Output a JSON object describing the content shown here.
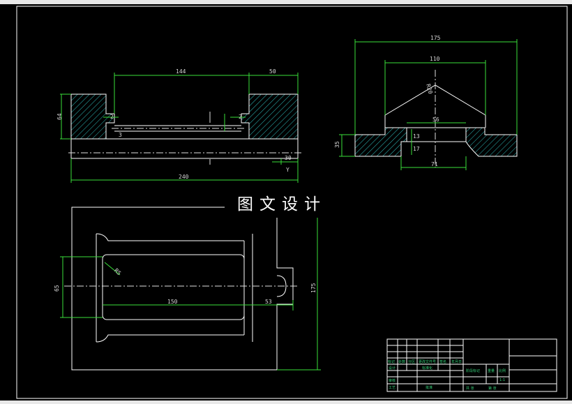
{
  "colors": {
    "background": "#000000",
    "outline": "#ffffff",
    "dimension": "#3adf3a",
    "hatch": "#2fbfbf",
    "centerline": "#e0e0e0",
    "text": "#d8d8d8",
    "title_block_text": "#36d27a"
  },
  "watermark": "图文设计",
  "front_view": {
    "dims": {
      "length_144": "144",
      "length_50": "50",
      "height_64": "64",
      "depth_2_left": "2",
      "depth_2_right": "2",
      "small_3": "3",
      "dim_30": "30",
      "total_240": "240"
    },
    "section_label": "Y"
  },
  "side_view": {
    "dims": {
      "width_175": "175",
      "width_110": "110",
      "radius_r20": "R20",
      "width_56": "56",
      "height_35": "35",
      "small_13": "13",
      "small_17": "17",
      "width_71": "71"
    }
  },
  "top_view": {
    "dims": {
      "width_65": "65",
      "radius_r5": "R5",
      "length_150": "150",
      "length_53": "53",
      "height_175": "175"
    }
  },
  "title_block": {
    "row_labels": [
      "标记",
      "处数",
      "分区",
      "更改文件号",
      "签名",
      "年月日"
    ],
    "label_design": "设计",
    "label_standard": "标准化",
    "label_review": "审核",
    "label_process": "工艺",
    "label_approve": "批准",
    "label_stage_mark": "阶段标记",
    "label_weight": "重量",
    "label_scale": "比例",
    "scale_value": "1:1",
    "sheet_total": "共   张",
    "sheet_num": "第   张"
  }
}
